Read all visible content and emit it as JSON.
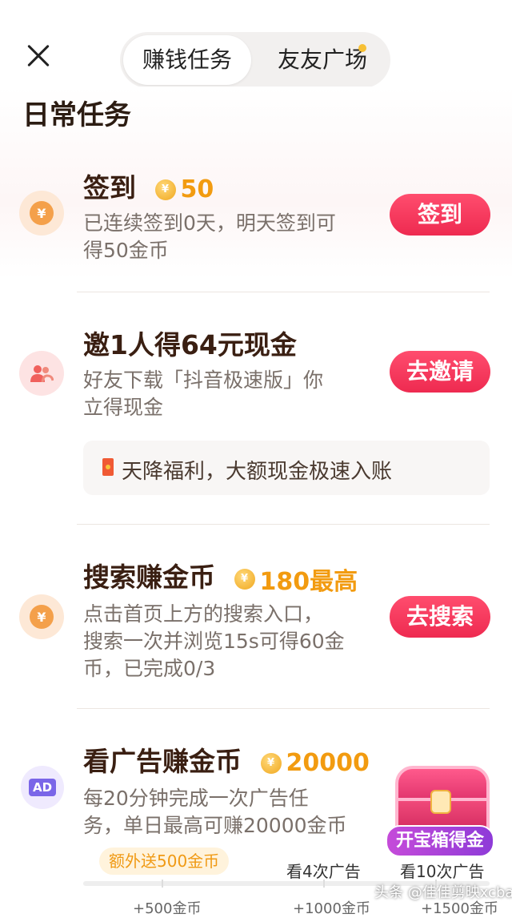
{
  "tabs": {
    "active": "赚钱任务",
    "second": "友友广场"
  },
  "section_title": "日常任务",
  "tasks": [
    {
      "title": "签到",
      "reward": "50",
      "desc_lines": [
        "已连续签到0天，明天签到可",
        "得50金币"
      ],
      "button": "签到",
      "icon": "yuan-coin-icon",
      "icon_text": "¥"
    },
    {
      "title": "邀1人得64元现金",
      "desc_lines": [
        "好友下载「抖音极速版」你",
        "立得现金"
      ],
      "button": "去邀请",
      "icon": "invite-friends-icon"
    },
    {
      "title": "搜索赚金币",
      "reward": "180最高",
      "desc_lines": [
        "点击首页上方的搜索入口，",
        "搜索一次并浏览15s可得60金",
        "币，已完成0/3"
      ],
      "button": "去搜索",
      "icon": "yuan-coin-icon",
      "icon_text": "¥"
    },
    {
      "title": "看广告赚金币",
      "reward": "20000",
      "desc_lines": [
        "每20分钟完成一次广告任",
        "务，单日最高可赚20000金币"
      ],
      "icon": "ad-icon",
      "icon_text": "AD"
    }
  ],
  "banner_text": "天降福利，大额现金极速入账",
  "ads_progress": {
    "extra_label": "额外送500金币",
    "milestones": [
      {
        "label": "看4次广告",
        "reward": "+1000金币"
      },
      {
        "label": "看10次广告",
        "reward": "+1500金币"
      }
    ],
    "first_reward": "+500金币"
  },
  "chest_label": "开宝箱得金",
  "coin_symbol": "¥",
  "watermark": "头条 @佳佳剪映xcba",
  "colors": {
    "accent_red": "#ee2a50",
    "coin_orange": "#f29b10"
  }
}
